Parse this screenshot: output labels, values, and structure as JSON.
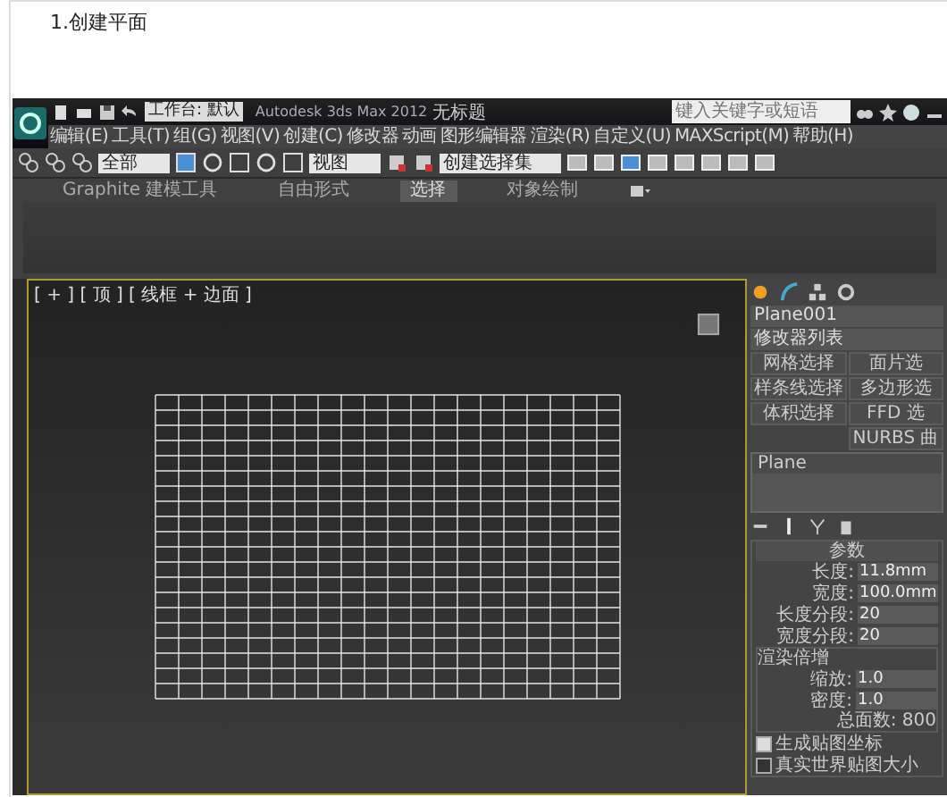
{
  "heading": "1.创建平面",
  "app": {
    "title": "Autodesk 3ds Max 2012",
    "document": "无标题",
    "workspace": "工作台: 默认",
    "search": {
      "placeholder": "键入关键字或短语"
    },
    "menu": [
      "编辑(E)",
      "工具(T)",
      "组(G)",
      "视图(V)",
      "创建(C)",
      "修改器",
      "动画",
      "图形编辑器",
      "渲染(R)",
      "自定义(U)",
      "MAXScript(M)",
      "帮助(H)"
    ],
    "toolbar": {
      "selection_filter": "全部",
      "coordinate_system": "视图",
      "selection_set": "创建选择集"
    },
    "ribbon_tabs": [
      {
        "label": "Graphite 建模工具",
        "selected": false
      },
      {
        "label": "自由形式",
        "selected": false
      },
      {
        "label": "选择",
        "selected": true
      },
      {
        "label": "对象绘制",
        "selected": false
      }
    ],
    "viewport": {
      "label": "[ + ] [ 顶 ] [ 线框 + 边面 ]"
    },
    "command_panel": {
      "object_name": "Plane001",
      "modifier_list": "修改器列表",
      "modifier_buttons": [
        "网格选择",
        "面片选",
        "样条线选择",
        "多边形选",
        "体积选择",
        "FFD 选",
        "NURBS 曲"
      ],
      "stack": [
        "Plane"
      ],
      "parameters": {
        "title": "参数",
        "fields": [
          {
            "label": "长度:",
            "value": "11.8mm"
          },
          {
            "label": "宽度:",
            "value": "100.0mm"
          },
          {
            "label": "长度分段:",
            "value": "20"
          },
          {
            "label": "宽度分段:",
            "value": "20"
          }
        ],
        "group_title": "渲染倍增",
        "group_fields": [
          {
            "label": "缩放:",
            "value": "1.0"
          },
          {
            "label": "密度:",
            "value": "1.0"
          }
        ],
        "total_faces": "总面数: 800",
        "checkboxes": [
          {
            "label": "生成贴图坐标",
            "checked": true
          },
          {
            "label": "真实世界贴图大小",
            "checked": false
          }
        ]
      }
    }
  }
}
